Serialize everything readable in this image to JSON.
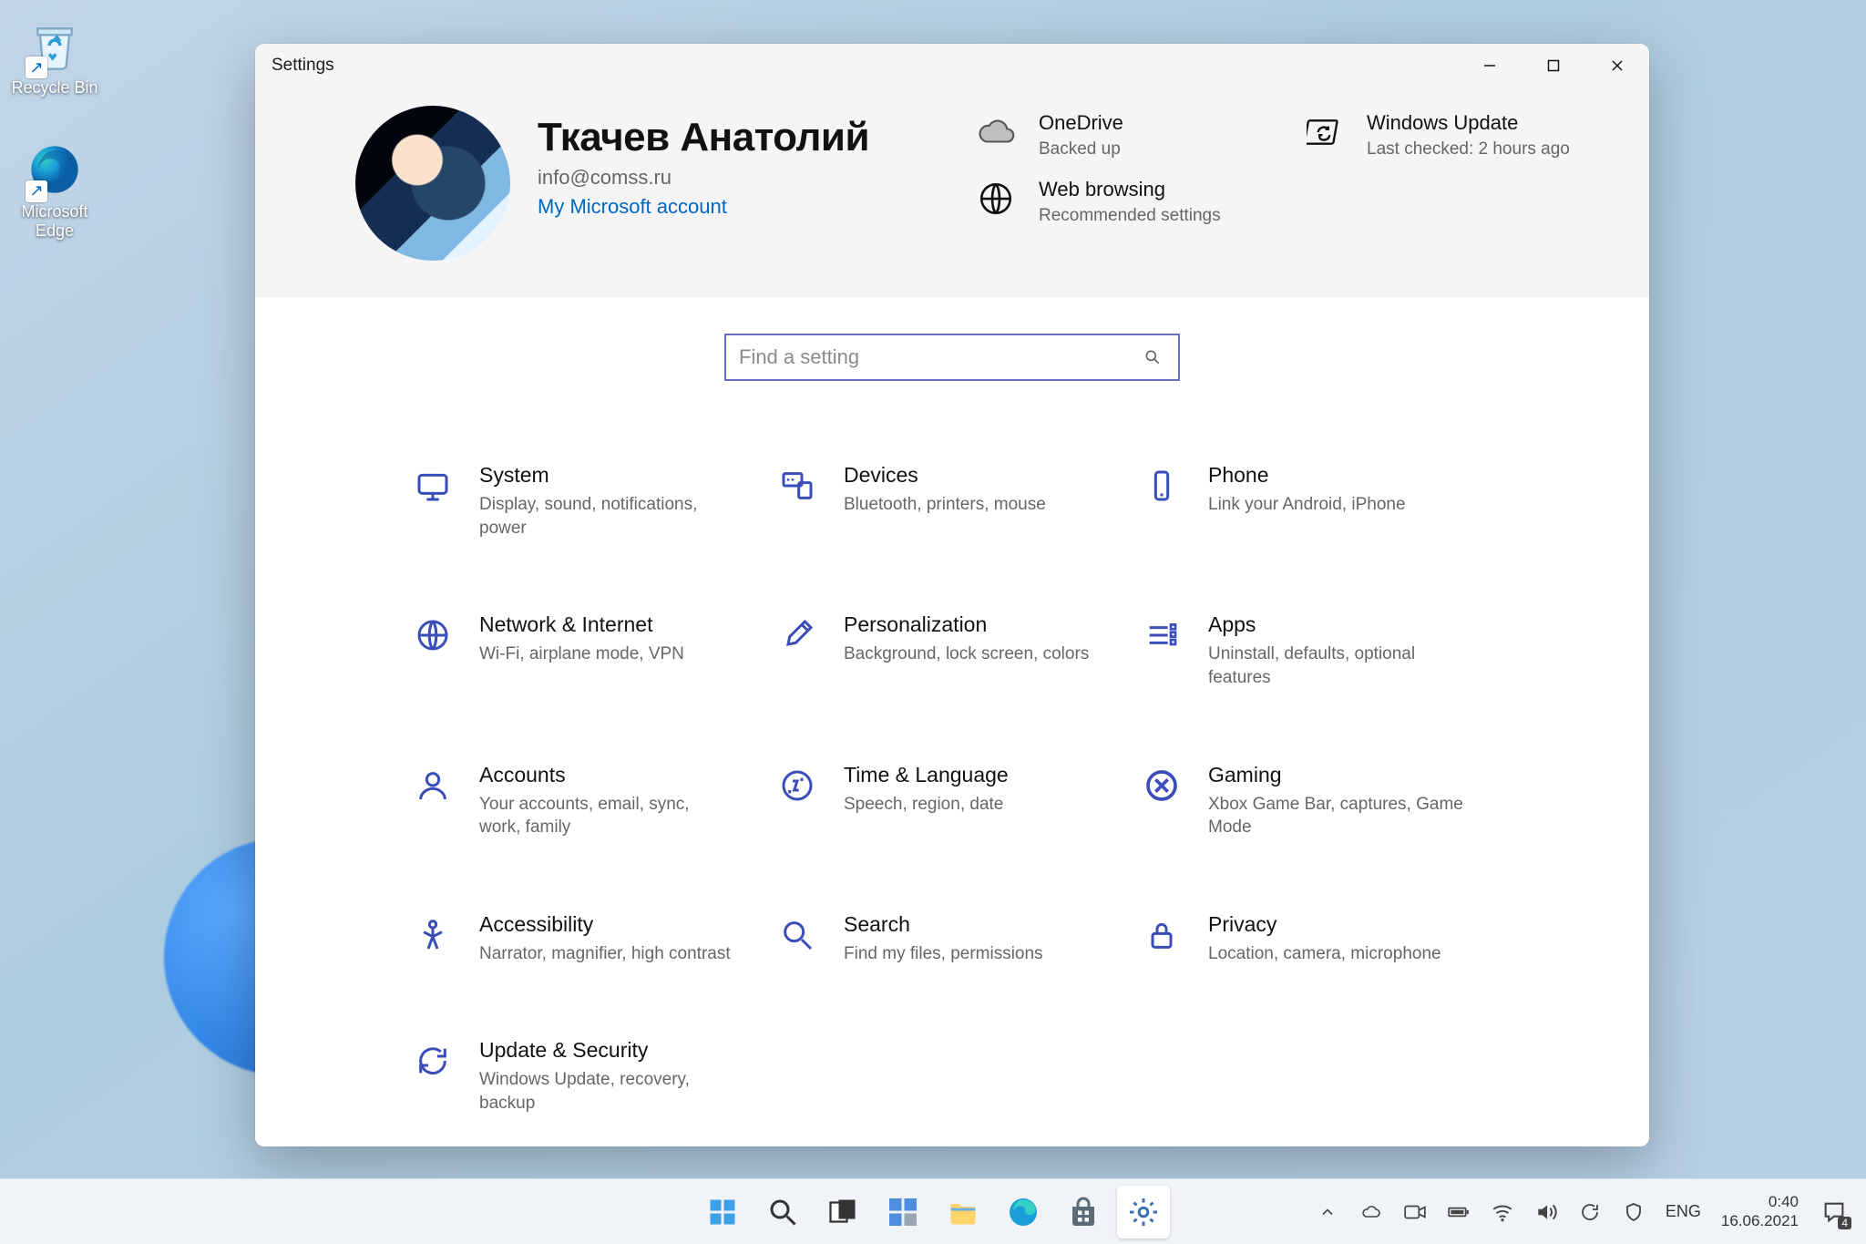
{
  "desktop": {
    "recycle_bin": "Recycle Bin",
    "edge": "Microsoft Edge"
  },
  "window": {
    "title": "Settings"
  },
  "user": {
    "name": "Ткачев Анатолий",
    "email": "info@comss.ru",
    "account_link": "My Microsoft account"
  },
  "status": {
    "onedrive": {
      "title": "OneDrive",
      "sub": "Backed up"
    },
    "update": {
      "title": "Windows Update",
      "sub": "Last checked: 2 hours ago"
    },
    "web": {
      "title": "Web browsing",
      "sub": "Recommended settings"
    }
  },
  "search": {
    "placeholder": "Find a setting"
  },
  "categories": [
    {
      "title": "System",
      "sub": "Display, sound, notifications, power"
    },
    {
      "title": "Devices",
      "sub": "Bluetooth, printers, mouse"
    },
    {
      "title": "Phone",
      "sub": "Link your Android, iPhone"
    },
    {
      "title": "Network & Internet",
      "sub": "Wi-Fi, airplane mode, VPN"
    },
    {
      "title": "Personalization",
      "sub": "Background, lock screen, colors"
    },
    {
      "title": "Apps",
      "sub": "Uninstall, defaults, optional features"
    },
    {
      "title": "Accounts",
      "sub": "Your accounts, email, sync, work, family"
    },
    {
      "title": "Time & Language",
      "sub": "Speech, region, date"
    },
    {
      "title": "Gaming",
      "sub": "Xbox Game Bar, captures, Game Mode"
    },
    {
      "title": "Accessibility",
      "sub": "Narrator, magnifier, high contrast"
    },
    {
      "title": "Search",
      "sub": "Find my files, permissions"
    },
    {
      "title": "Privacy",
      "sub": "Location, camera, microphone"
    },
    {
      "title": "Update & Security",
      "sub": "Windows Update, recovery, backup"
    }
  ],
  "tray": {
    "lang": "ENG",
    "time": "0:40",
    "date": "16.06.2021",
    "notif_count": "4"
  }
}
